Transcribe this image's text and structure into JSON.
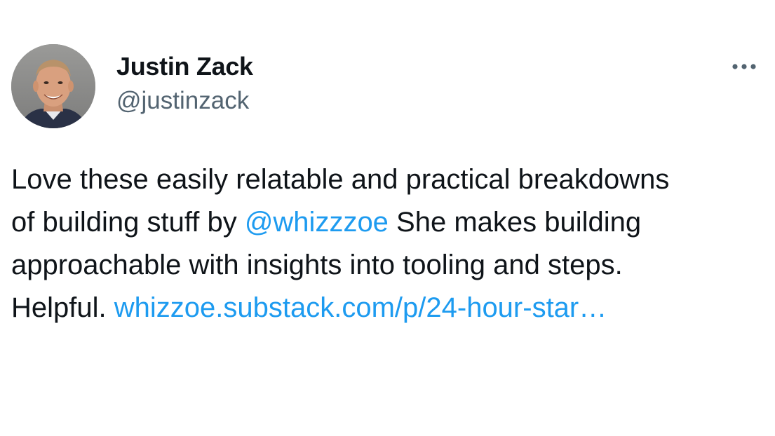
{
  "author": {
    "name": "Justin Zack",
    "handle": "@justinzack",
    "avatar_alt": "profile photo"
  },
  "menu": {
    "icon": "more-horizontal-icon"
  },
  "tweet": {
    "line1_plain": "Love these easily relatable and ",
    "line1_highlight": "practical breakdowns",
    "line2_highlight_text": "of building stuff by ",
    "line2_mention": "@whizzzoe",
    "line2_rest": " She makes building",
    "line3": "approachable with insights into tooling and steps.",
    "line4_plain": "Helpful. ",
    "line4_link": "whizzoe.substack.com/p/24-hour-star…"
  },
  "colors": {
    "link": "#1d9bf0",
    "highlight": "#ffff00",
    "secondary_text": "#536471",
    "primary_text": "#0f1419"
  }
}
